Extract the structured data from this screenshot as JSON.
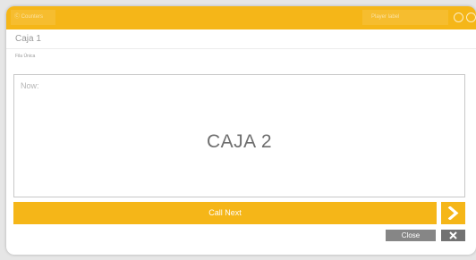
{
  "topbar": {
    "left_label": "Ⓒ Counters",
    "right_label": "Player label",
    "icons": [
      "circle-icon",
      "circle-icon"
    ]
  },
  "header": {
    "title": "Caja 1"
  },
  "sub_label": "Fila Única",
  "display": {
    "now_label": "Now:",
    "counter_name": "CAJA 2"
  },
  "actions": {
    "call_next_label": "Call Next",
    "next_icon": "chevron-right-icon",
    "close_label": "Close",
    "close_icon": "x-icon"
  },
  "colors": {
    "accent": "#f5b618",
    "close_button": "#868686",
    "x_button": "#727272"
  }
}
